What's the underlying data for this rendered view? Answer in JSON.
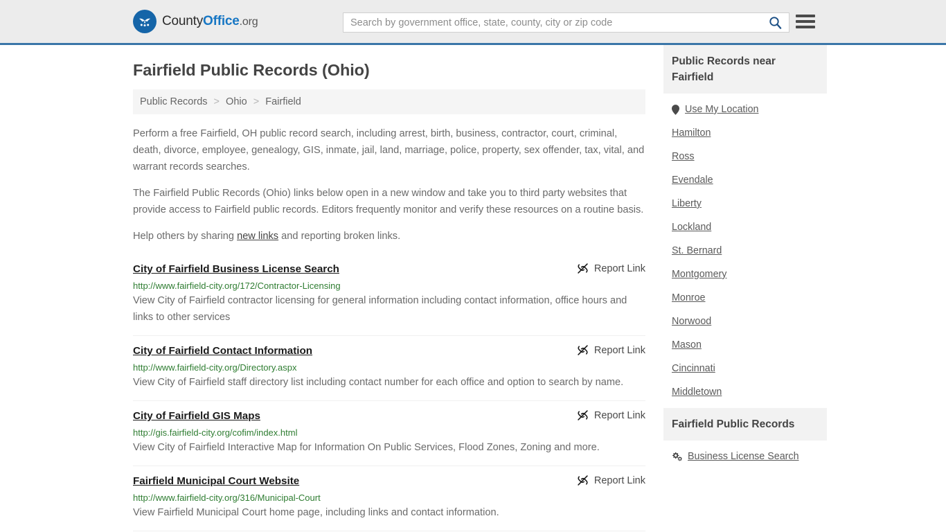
{
  "header": {
    "brand": {
      "part1": "County",
      "part2": "Office",
      "tld": ".org"
    },
    "search": {
      "placeholder": "Search by government office, state, county, city or zip code",
      "value": "",
      "search_icon": "search-icon"
    },
    "menu_icon": "hamburger-menu-icon"
  },
  "page": {
    "title": "Fairfield Public Records (Ohio)",
    "breadcrumb": [
      {
        "label": "Public Records"
      },
      {
        "label": "Ohio"
      },
      {
        "label": "Fairfield"
      }
    ],
    "breadcrumb_separator": ">",
    "intro": {
      "p1": "Perform a free Fairfield, OH public record search, including arrest, birth, business, contractor, court, criminal, death, divorce, employee, genealogy, GIS, inmate, jail, land, marriage, police, property, sex offender, tax, vital, and warrant records searches.",
      "p2": "The Fairfield Public Records (Ohio) links below open in a new window and take you to third party websites that provide access to Fairfield public records. Editors frequently monitor and verify these resources on a routine basis.",
      "p3_before": "Help others by sharing ",
      "p3_link": "new links",
      "p3_after": " and reporting broken links."
    }
  },
  "results": {
    "report_label": "Report Link",
    "report_icon": "broken-link-icon",
    "items": [
      {
        "title": "City of Fairfield Business License Search",
        "url": "http://www.fairfield-city.org/172/Contractor-Licensing",
        "description": "View City of Fairfield contractor licensing for general information including contact information, office hours and links to other services"
      },
      {
        "title": "City of Fairfield Contact Information",
        "url": "http://www.fairfield-city.org/Directory.aspx",
        "description": "View City of Fairfield staff directory list including contact number for each office and option to search by name."
      },
      {
        "title": "City of Fairfield GIS Maps",
        "url": "http://gis.fairfield-city.org/cofim/index.html",
        "description": "View City of Fairfield Interactive Map for Information On Public Services, Flood Zones, Zoning and more."
      },
      {
        "title": "Fairfield Municipal Court Website",
        "url": "http://www.fairfield-city.org/316/Municipal-Court",
        "description": "View Fairfield Municipal Court home page, including links and contact information."
      }
    ]
  },
  "sidebar": {
    "near": {
      "heading": "Public Records near Fairfield",
      "use_my_location": "Use My Location",
      "location_icon": "map-pin-icon",
      "cities": [
        "Hamilton",
        "Ross",
        "Evendale",
        "Liberty",
        "Lockland",
        "St. Bernard",
        "Montgomery",
        "Monroe",
        "Norwood",
        "Mason",
        "Cincinnati",
        "Middletown"
      ]
    },
    "records": {
      "heading": "Fairfield Public Records",
      "items": [
        {
          "label": "Business License Search",
          "icon": "cogs-icon"
        }
      ]
    }
  },
  "colors": {
    "header_bg": "#ececec",
    "header_border": "#3a76a8",
    "brand_blue": "#1877c4",
    "url_green": "#2f7d32",
    "panel_gray": "#f2f2f2"
  }
}
